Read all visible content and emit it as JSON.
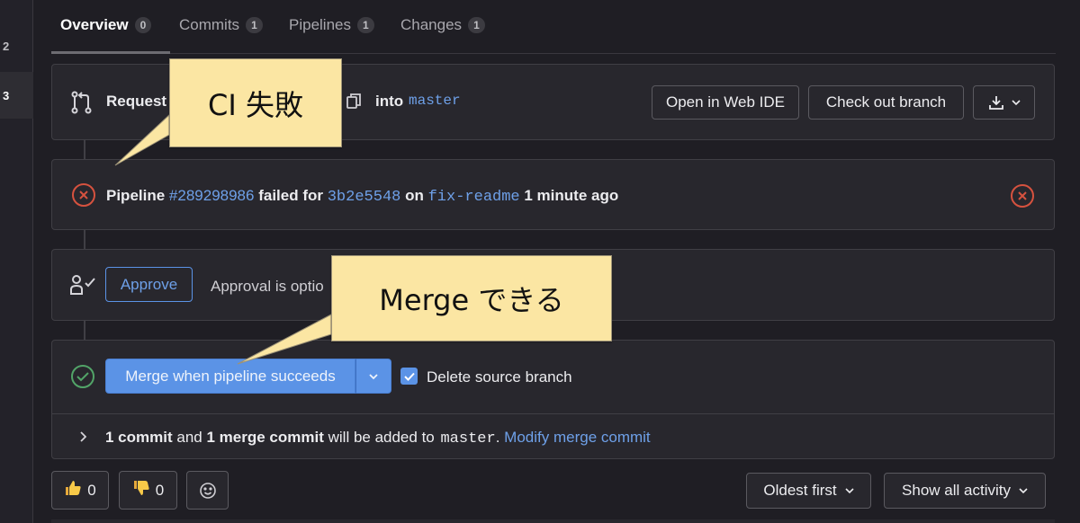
{
  "rail": {
    "items": [
      "2",
      "3"
    ]
  },
  "tabs": [
    {
      "label": "Overview",
      "count": "0"
    },
    {
      "label": "Commits",
      "count": "1"
    },
    {
      "label": "Pipelines",
      "count": "1"
    },
    {
      "label": "Changes",
      "count": "1"
    }
  ],
  "header": {
    "request_text": "Request",
    "into_text": "into",
    "branch": "master",
    "open_ide": "Open in Web IDE",
    "checkout": "Check out branch"
  },
  "pipeline": {
    "prefix": "Pipeline",
    "id": "#289298986",
    "failed_for": "failed for",
    "commit": "3b2e5548",
    "on": "on",
    "branch": "fix-readme",
    "time": "1 minute ago"
  },
  "approval": {
    "approve_label": "Approve",
    "text": "Approval is optio"
  },
  "merge": {
    "button_label": "Merge when pipeline succeeds",
    "delete_label": "Delete source branch",
    "summary_a": "1 commit",
    "summary_and": "and",
    "summary_b": "1 merge commit",
    "summary_c": "will be added to",
    "summary_branch": "master",
    "summary_dot": ".",
    "modify": "Modify merge commit"
  },
  "reactions": {
    "thumbs_up": "0",
    "thumbs_down": "0"
  },
  "sort": {
    "order": "Oldest first",
    "filter": "Show all activity"
  },
  "callouts": {
    "ci": "CI 失敗",
    "merge": "Merge できる"
  },
  "colors": {
    "link": "#6ea0e8",
    "failed": "#d6523f",
    "success": "#52a468",
    "primary": "#5b93e6",
    "callout": "#fbe6a3"
  }
}
